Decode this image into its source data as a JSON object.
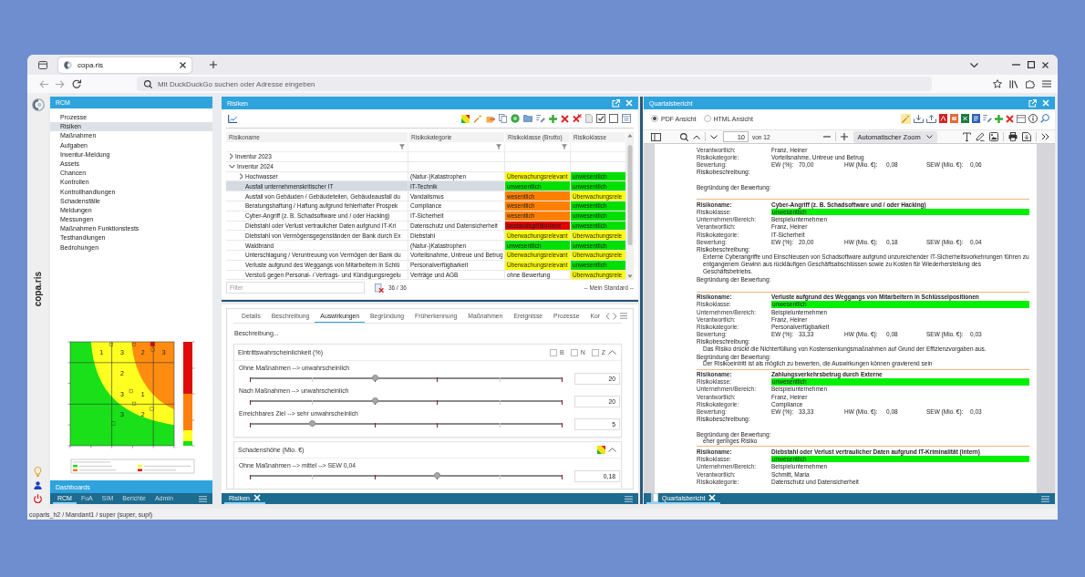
{
  "browser": {
    "tabs": [
      {
        "title": "copa.ris",
        "selected": true
      }
    ],
    "address_bar": {
      "placeholder": "Mit DuckDuckGo suchen oder Adresse eingeben"
    }
  },
  "sidebar": {
    "brand": "copa.ris"
  },
  "rcm_panel": {
    "title": "RCM",
    "nav_items": [
      {
        "label": "Prozesse",
        "selected": false
      },
      {
        "label": "Risiken",
        "selected": true
      },
      {
        "label": "Maßnahmen",
        "selected": false
      },
      {
        "label": "Aufgaben",
        "selected": false
      },
      {
        "label": "Inventur-Meldung",
        "selected": false
      },
      {
        "label": "Assets",
        "selected": false
      },
      {
        "label": "Chancen",
        "selected": false
      },
      {
        "label": "Kontrollen",
        "selected": false
      },
      {
        "label": "Kontrollhandlungen",
        "selected": false
      },
      {
        "label": "Schadensfälle",
        "selected": false
      },
      {
        "label": "Meldungen",
        "selected": false
      },
      {
        "label": "Messungen",
        "selected": false
      },
      {
        "label": "Maßnahmen Funktionstests",
        "selected": false
      },
      {
        "label": "Testhandlungen",
        "selected": false
      },
      {
        "label": "Bedrohungen",
        "selected": false
      }
    ],
    "risk_matrix": {
      "counts": [
        "1",
        "3",
        "2",
        "3",
        "2",
        "3",
        "1",
        "3",
        "2"
      ]
    },
    "dashboards_title": "Dashboards",
    "tabs": [
      {
        "label": "RCM",
        "selected": true
      },
      {
        "label": "FuA",
        "selected": false
      },
      {
        "label": "SIM",
        "selected": false
      },
      {
        "label": "Berichte",
        "selected": false
      },
      {
        "label": "Admin",
        "selected": false
      }
    ]
  },
  "risks_panel": {
    "title": "Risiken",
    "table": {
      "columns": [
        {
          "label": "Risikoname",
          "filter": true
        },
        {
          "label": "Risikokategorie",
          "filter": true
        },
        {
          "label": "Risikoklasse (Brutto)",
          "filter": true
        },
        {
          "label": "Risikoklasse",
          "filter": false
        }
      ],
      "rows": [
        {
          "name": "Inventur 2023",
          "expanded": false,
          "selected": false
        },
        {
          "name": "Inventur 2024",
          "expanded": true,
          "selected": false,
          "children": [
            {
              "name": "Hochwasser",
              "expanded": false,
              "selected": false,
              "category": "(Natur-)Katastrophen",
              "class_gross": {
                "text": "Überwachungsrelevant",
                "color": "#ffff00"
              },
              "class_net": {
                "text": "unwesentlich",
                "color": "#00e000"
              }
            },
            {
              "name": "Ausfall unternehmenskritischer IT",
              "selected": true,
              "category": "IT-Technik",
              "class_gross": {
                "text": "unwesentlich",
                "color": "#00e000"
              },
              "class_net": {
                "text": "unwesentlich",
                "color": "#00e000"
              }
            },
            {
              "name": "Ausfall von Gebäuden / Gebäudeteilen, Gebäudeausfall du",
              "selected": false,
              "category": "Vandalismus",
              "class_gross": {
                "text": "wesentlich",
                "color": "#ff8000"
              },
              "class_net": {
                "text": "Überwachungsrele",
                "color": "#ffff00"
              }
            },
            {
              "name": "Beratungshaftung / Haftung aufgrund fehlerhafter Prospek",
              "selected": false,
              "category": "Compliance",
              "class_gross": {
                "text": "wesentlich",
                "color": "#ff8000"
              },
              "class_net": {
                "text": "unwesentlich",
                "color": "#00e000"
              }
            },
            {
              "name": "Cyber-Angriff (z. B. Schadsoftware und / oder Hacking)",
              "selected": false,
              "category": "IT-Sicherheit",
              "class_gross": {
                "text": "wesentlich",
                "color": "#ff8000"
              },
              "class_net": {
                "text": "unwesentlich",
                "color": "#00e000"
              }
            },
            {
              "name": "Diebstahl oder Verlust vertraulicher Daten aufgrund IT-Kri",
              "selected": false,
              "category": "Datenschutz und Datensicherheit",
              "class_gross": {
                "text": "bestandsgefährdend",
                "color": "#e00000"
              },
              "class_net": {
                "text": "unwesentlich",
                "color": "#00e000"
              }
            },
            {
              "name": "Diebstahl von Vermögensgegenständen der Bank durch Ex",
              "selected": false,
              "category": "Diebstahl",
              "class_gross": {
                "text": "Überwachungsrelevant",
                "color": "#ffff00"
              },
              "class_net": {
                "text": "Überwachungsrele",
                "color": "#ffff00"
              }
            },
            {
              "name": "Waldbrand",
              "selected": false,
              "category": "(Natur-)Katastrophen",
              "class_gross": {
                "text": "unwesentlich",
                "color": "#00e000"
              },
              "class_net": {
                "text": "unwesentlich",
                "color": "#00e000"
              }
            },
            {
              "name": "Unterschlagung / Veruntreuung von Vermögen der Bank du",
              "selected": false,
              "category": "Vorteilsnahme, Untreue und Betrug",
              "class_gross": {
                "text": "Überwachungsrelevant",
                "color": "#ffff00"
              },
              "class_net": {
                "text": "Überwachungsrele",
                "color": "#ffff00"
              }
            },
            {
              "name": "Verluste aufgrund des Weggangs von Mitarbeitern in Schlü",
              "selected": false,
              "category": "Personalverfügbarkeit",
              "class_gross": {
                "text": "Überwachungsrelevant",
                "color": "#ffff00"
              },
              "class_net": {
                "text": "unwesentlich",
                "color": "#00e000"
              }
            },
            {
              "name": "Verstoß gegen Personal- / Vertrags- und Kündigungsregelu",
              "selected": false,
              "category": "Verträge und AGB",
              "class_gross": {
                "text": "ohne Bewertung"
              },
              "class_net": {
                "text": "Überwachungsrele",
                "color": "#ffff00"
              }
            }
          ]
        }
      ]
    },
    "filter": {
      "placeholder": "Filter"
    },
    "count": "36 / 36",
    "view": "-- Mein Standard --"
  },
  "details_panel": {
    "tabs": [
      {
        "label": "Details",
        "selected": false
      },
      {
        "label": "Beschreibung",
        "selected": false
      },
      {
        "label": "Auswirkungen",
        "selected": true
      },
      {
        "label": "Begründung",
        "selected": false
      },
      {
        "label": "Früherkennung",
        "selected": false
      },
      {
        "label": "Maßnahmen",
        "selected": false
      },
      {
        "label": "Ereignisse",
        "selected": false
      },
      {
        "label": "Prozesse",
        "selected": false
      },
      {
        "label": "Kor",
        "selected": false
      }
    ],
    "description": "Beschreibung...",
    "sections": [
      {
        "kind": "probability",
        "title": "Eintrittswahrscheinlichkeit (%)",
        "expanded": true,
        "options": [
          {
            "label": "B",
            "checked": false
          },
          {
            "label": "N",
            "checked": false
          },
          {
            "label": "Z",
            "checked": false
          }
        ],
        "sliders": [
          {
            "label": "Ohne Maßnahmen --> unwahrscheinlich",
            "level": 0.4,
            "value": "20"
          },
          {
            "label": "Nach Maßnahmen --> unwahrscheinlich",
            "level": 0.4,
            "value": "20"
          },
          {
            "label": "Erreichbares Ziel --> sehr unwahrscheinlich",
            "level": 0.2,
            "value": "5"
          }
        ]
      },
      {
        "kind": "impact",
        "title": "Schadenshöhe (Mio. €)",
        "expanded": true,
        "sliders": [
          {
            "label": "Ohne Maßnahmen --> mittel --> SEW 0,04",
            "level": 0.6,
            "value": "0,18"
          }
        ]
      }
    ],
    "bottom_tabs": [
      {
        "label": "Risiken",
        "selected": true
      }
    ]
  },
  "report_panel": {
    "title": "Quartalsbericht",
    "view_modes": [
      {
        "label": "PDF Ansicht",
        "selected": true
      },
      {
        "label": "HTML Ansicht",
        "selected": false
      }
    ],
    "viewer": {
      "page": "10",
      "page_count": "von 12",
      "zoom": "Automatischer Zoom"
    },
    "entries": [
      {
        "rows": [
          {
            "kind": "field",
            "label": "Verantwortlich:",
            "value": "Franz, Heiner"
          },
          {
            "kind": "field",
            "label": "Risikokategorie:",
            "value": "Vorteilsnahme, Untreue und Betrug"
          },
          {
            "kind": "rating",
            "label": "Bewertung:",
            "metrics": [
              {
                "label": "EW (%):",
                "value": "70,00"
              },
              {
                "label": "HW (Mio. €):",
                "value": "0,08"
              },
              {
                "label": "SEW (Mio. €):",
                "value": "0,06"
              }
            ]
          },
          {
            "kind": "section",
            "label": "Risikobeschreibung:"
          },
          {
            "kind": "section",
            "label": "Begründung der Bewertung:"
          }
        ]
      },
      {
        "rows": [
          {
            "kind": "name",
            "label": "Risikoname:",
            "value": "Cyber-Angriff (z. B. Schadsoftware und / oder Hacking)"
          },
          {
            "kind": "class",
            "label": "Risikoklasse:",
            "value": "unwesentlich",
            "color": "#00f000"
          },
          {
            "kind": "field",
            "label": "Unternehmen/Bereich:",
            "value": "Beispielunternehmen"
          },
          {
            "kind": "field",
            "label": "Verantwortlich:",
            "value": "Franz, Heiner"
          },
          {
            "kind": "field",
            "label": "Risikokategorie:",
            "value": "IT-Sicherheit"
          },
          {
            "kind": "rating",
            "label": "Bewertung:",
            "metrics": [
              {
                "label": "EW (%):",
                "value": "20,00"
              },
              {
                "label": "HW (Mio. €):",
                "value": "0,18"
              },
              {
                "label": "SEW (Mio. €):",
                "value": "0,04"
              }
            ]
          },
          {
            "kind": "section",
            "label": "Risikobeschreibung:",
            "text": "Externe Cyberangriffe und Einschleusen von Schadsoftware aufgrund unzureichender IT-Sicherheitsvorkehrungen führen zu entgangenem Gewinn aus rückläufigen Geschäftsabschlüssen sowie zu Kosten für Wiederherstellung des Geschäftsbetriebs."
          },
          {
            "kind": "section",
            "label": "Begründung der Bewertung:"
          }
        ]
      },
      {
        "rows": [
          {
            "kind": "name",
            "label": "Risikoname:",
            "value": "Verluste aufgrund des Weggangs von Mitarbeitern in Schlüsselpositionen"
          },
          {
            "kind": "class",
            "label": "Risikoklasse:",
            "value": "unwesentlich",
            "color": "#00f000"
          },
          {
            "kind": "field",
            "label": "Unternehmen/Bereich:",
            "value": "Beispielunternehmen"
          },
          {
            "kind": "field",
            "label": "Verantwortlich:",
            "value": "Franz, Heiner"
          },
          {
            "kind": "field",
            "label": "Risikokategorie:",
            "value": "Personalverfügbarkeit"
          },
          {
            "kind": "rating",
            "label": "Bewertung:",
            "metrics": [
              {
                "label": "EW (%):",
                "value": "33,33"
              },
              {
                "label": "HW (Mio. €):",
                "value": "0,08"
              },
              {
                "label": "SEW (Mio. €):",
                "value": "0,03"
              }
            ]
          },
          {
            "kind": "section",
            "label": "Risikobeschreibung:",
            "text": "Das Risiko drückt die Nichterfüllung von Kostensenkungsmaßnahmen auf Grund der Effizienzvorgaben aus."
          },
          {
            "kind": "section",
            "label": "Begründung der Bewertung:",
            "text": "Der Risikoeintritt ist als möglich zu bewerten, die Auswirkungen können gravierend sein"
          }
        ]
      },
      {
        "rows": [
          {
            "kind": "name",
            "label": "Risikoname:",
            "value": "Zahlungsverkehrsbetrug durch Externe"
          },
          {
            "kind": "class",
            "label": "Risikoklasse:",
            "value": "unwesentlich",
            "color": "#00f000"
          },
          {
            "kind": "field",
            "label": "Unternehmen/Bereich:",
            "value": "Beispielunternehmen"
          },
          {
            "kind": "field",
            "label": "Verantwortlich:",
            "value": "Franz, Heiner"
          },
          {
            "kind": "field",
            "label": "Risikokategorie:",
            "value": "Compliance"
          },
          {
            "kind": "rating",
            "label": "Bewertung:",
            "metrics": [
              {
                "label": "EW (%):",
                "value": "33,33"
              },
              {
                "label": "HW (Mio. €):",
                "value": "0,08"
              },
              {
                "label": "SEW (Mio. €):",
                "value": "0,03"
              }
            ]
          },
          {
            "kind": "section",
            "label": "Risikobeschreibung:"
          },
          {
            "kind": "section",
            "label": "Begründung der Bewertung:",
            "text": "eher geringes Risiko"
          }
        ]
      },
      {
        "rows": [
          {
            "kind": "name",
            "label": "Risikoname:",
            "value": "Diebstahl oder Verlust vertraulicher Daten aufgrund IT-Kriminalität (intern)"
          },
          {
            "kind": "class",
            "label": "Risikoklasse:",
            "value": "unwesentlich",
            "color": "#00f000"
          },
          {
            "kind": "field",
            "label": "Unternehmen/Bereich:",
            "value": "Beispielunternehmen"
          },
          {
            "kind": "field",
            "label": "Verantwortlich:",
            "value": "Schmitt, Maria"
          },
          {
            "kind": "field",
            "label": "Risikokategorie:",
            "value": "Datenschutz und Datensicherheit"
          }
        ]
      }
    ],
    "bottom_tabs": [
      {
        "label": "Quartalsbericht",
        "selected": true
      }
    ]
  },
  "status_bar": {
    "text": "coparis_h2 / Mandant1 / super (super, supl)"
  }
}
